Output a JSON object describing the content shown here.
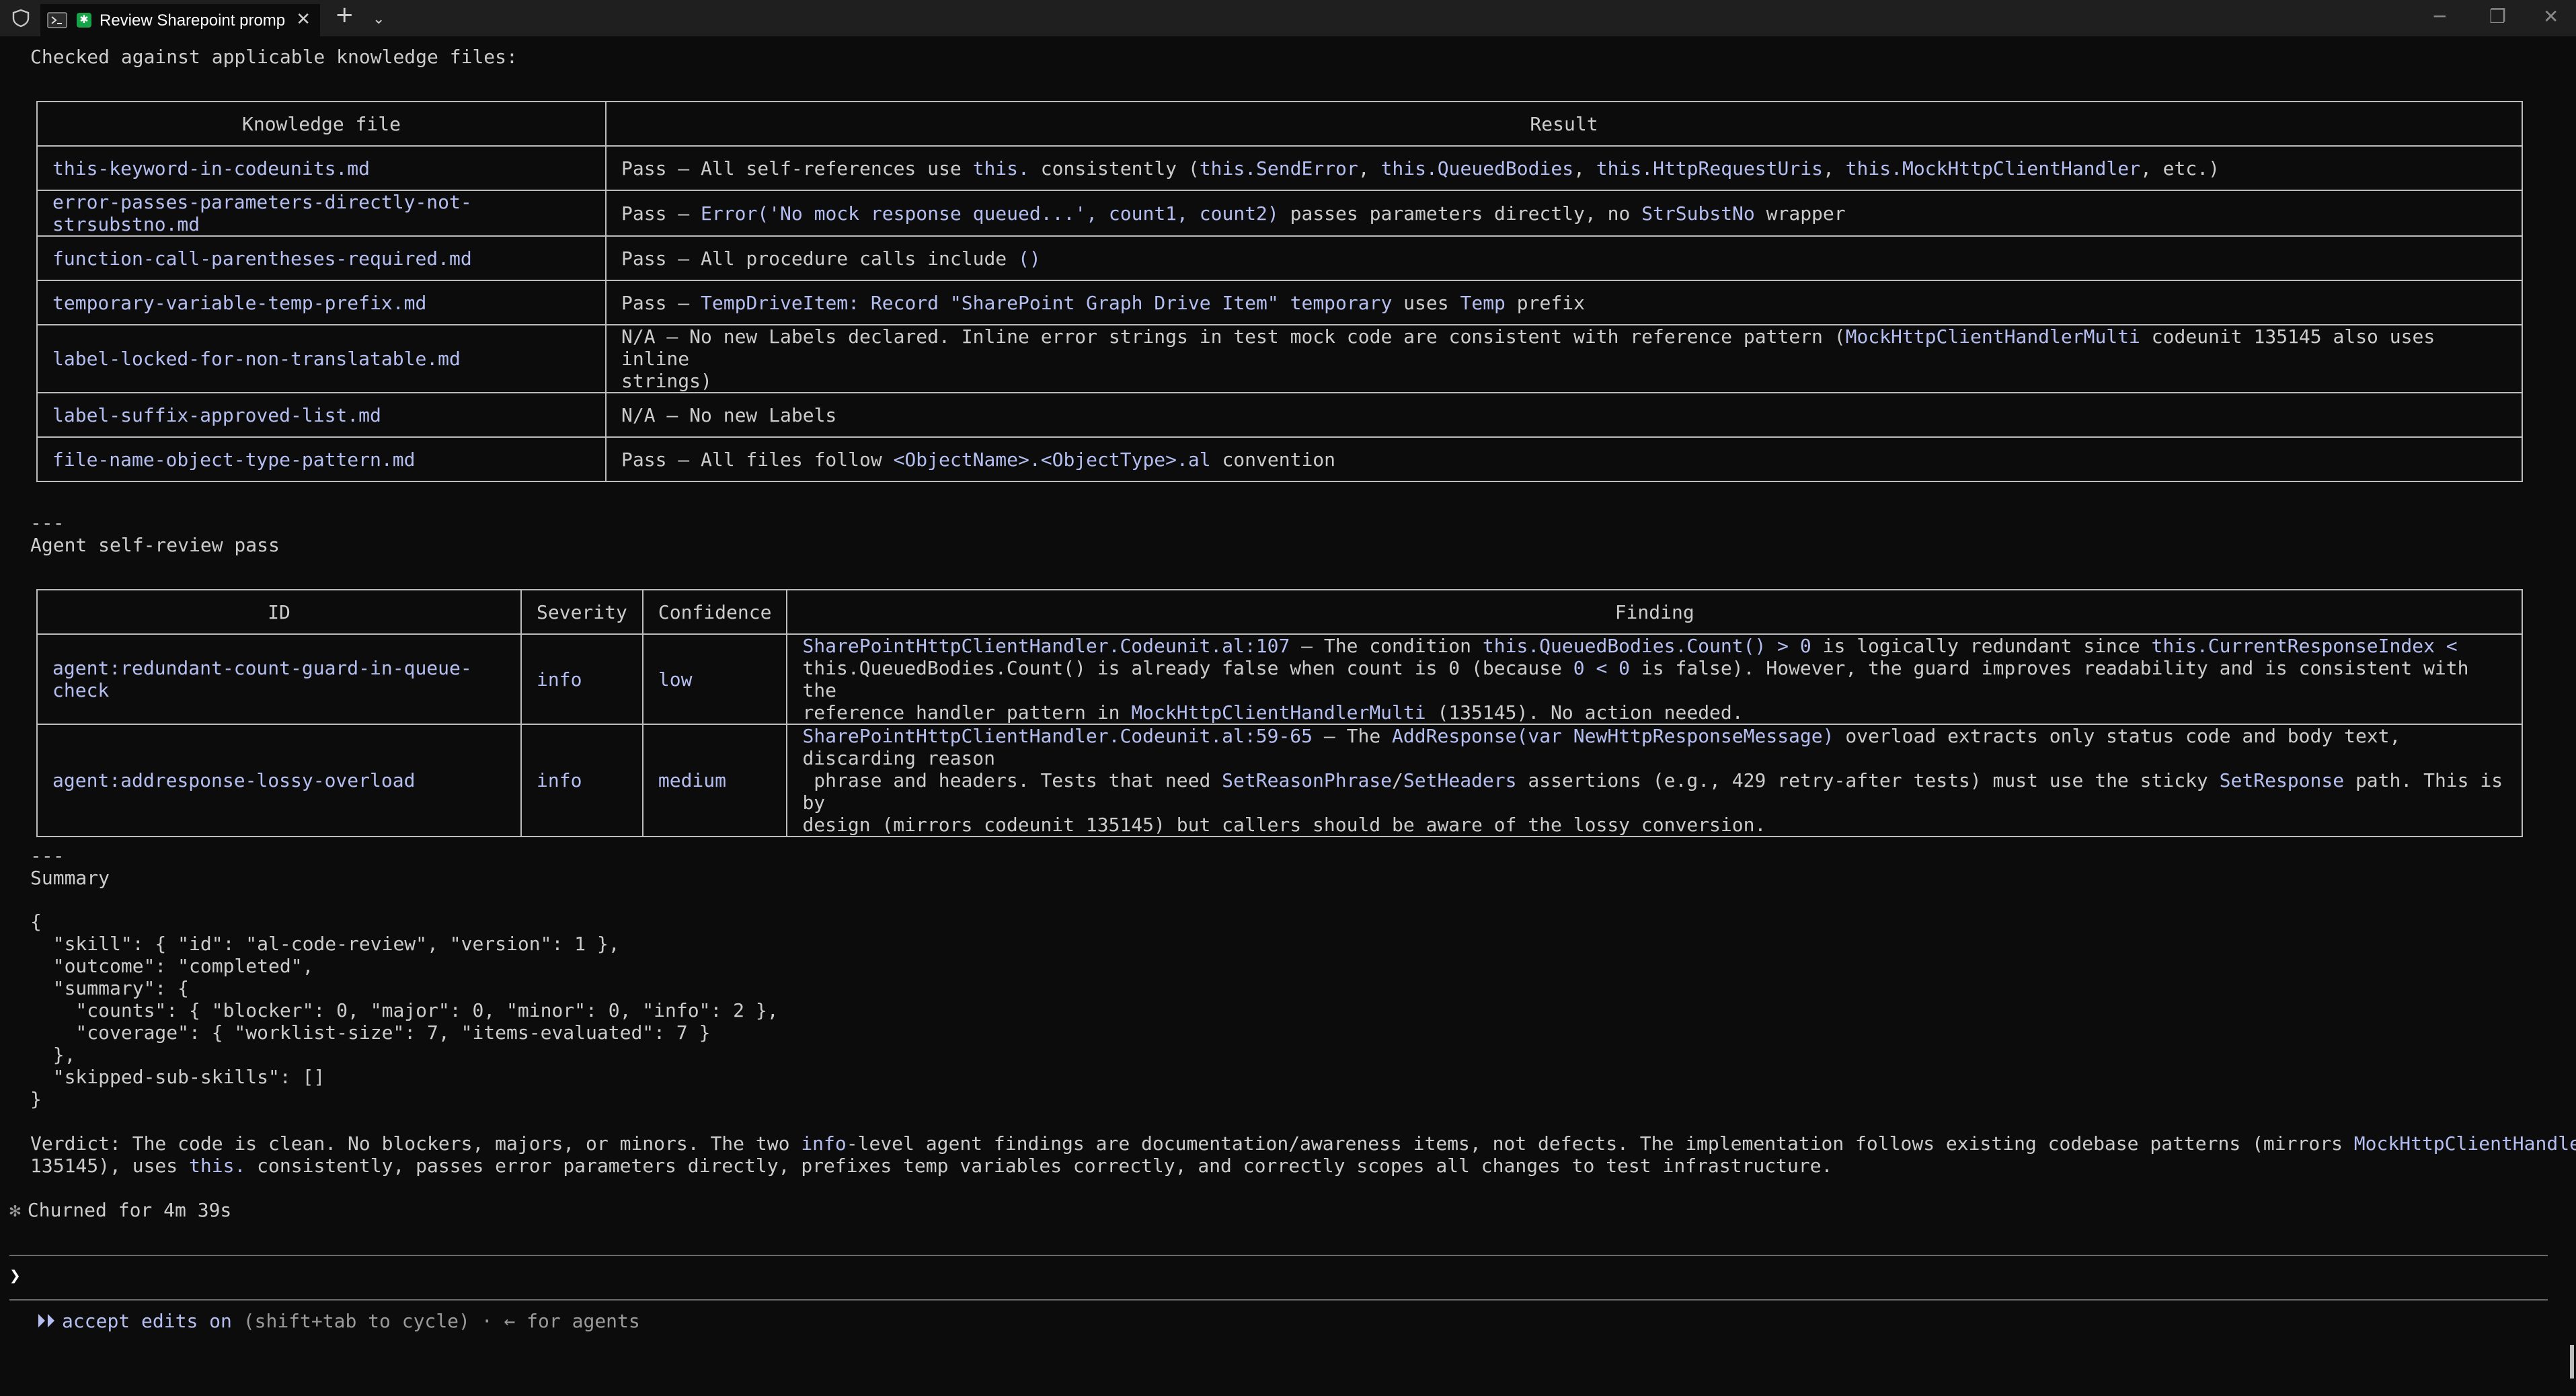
{
  "window": {
    "tab_title": "Review Sharepoint promp",
    "minimize": "─",
    "restore": "❐",
    "close": "✕",
    "new_tab": "+",
    "dropdown": "⌄"
  },
  "intro_line": "Checked against applicable knowledge files:",
  "knowledge_table": {
    "headers": [
      "Knowledge file",
      "Result"
    ],
    "rows": [
      {
        "file": "this-keyword-in-codeunits.md",
        "result": [
          [
            "Pass — All self-references use ",
            ""
          ],
          [
            "this.",
            "h"
          ],
          [
            " consistently (",
            ""
          ],
          [
            "this.SendError",
            "h"
          ],
          [
            ", ",
            ""
          ],
          [
            "this.QueuedBodies",
            "h"
          ],
          [
            ", ",
            ""
          ],
          [
            "this.HttpRequestUris",
            "h"
          ],
          [
            ", ",
            ""
          ],
          [
            "this.MockHttpClientHandler",
            "h"
          ],
          [
            ", etc.)",
            ""
          ]
        ]
      },
      {
        "file": "error-passes-parameters-directly-not-strsubstno.md",
        "result": [
          [
            "Pass — ",
            ""
          ],
          [
            "Error('No mock response queued...', count1, count2)",
            "h"
          ],
          [
            " passes parameters directly, no ",
            ""
          ],
          [
            "StrSubstNo",
            "h"
          ],
          [
            " wrapper",
            ""
          ]
        ]
      },
      {
        "file": "function-call-parentheses-required.md",
        "result": [
          [
            "Pass — All procedure calls include ",
            ""
          ],
          [
            "()",
            "h"
          ]
        ]
      },
      {
        "file": "temporary-variable-temp-prefix.md",
        "result": [
          [
            "Pass — ",
            ""
          ],
          [
            "TempDriveItem: Record \"SharePoint Graph Drive Item\" temporary",
            "h"
          ],
          [
            " uses ",
            ""
          ],
          [
            "Temp",
            "h"
          ],
          [
            " prefix",
            ""
          ]
        ]
      },
      {
        "file": "label-locked-for-non-translatable.md",
        "result": [
          [
            "N/A — No new Labels declared. Inline error strings in test mock code are consistent with reference pattern (",
            ""
          ],
          [
            "MockHttpClientHandlerMulti",
            "h"
          ],
          [
            " codeunit 135145 also uses inline\nstrings)",
            ""
          ]
        ]
      },
      {
        "file": "label-suffix-approved-list.md",
        "result": [
          [
            "N/A — No new Labels",
            ""
          ]
        ]
      },
      {
        "file": "file-name-object-type-pattern.md",
        "result": [
          [
            "Pass — All files follow ",
            ""
          ],
          [
            "<ObjectName>.<ObjectType>.al",
            "h"
          ],
          [
            " convention",
            ""
          ]
        ]
      }
    ]
  },
  "sep1": "---",
  "self_review_heading": "Agent self-review pass",
  "findings_table": {
    "headers": [
      "ID",
      "Severity",
      "Confidence",
      "Finding"
    ],
    "rows": [
      {
        "id": "agent:redundant-count-guard-in-queue-check",
        "severity": "info",
        "confidence": "low",
        "finding": [
          [
            "SharePointHttpClientHandler.Codeunit.al:107",
            "h"
          ],
          [
            " — The condition ",
            ""
          ],
          [
            "this.QueuedBodies.Count() > 0",
            "h"
          ],
          [
            " is logically redundant since ",
            ""
          ],
          [
            "this.CurrentResponseIndex <",
            "h"
          ],
          [
            "\nthis.QueuedBodies.Count() is already false when count is 0 (because ",
            ""
          ],
          [
            "0 < 0",
            "h"
          ],
          [
            " is false). However, the guard improves readability and is consistent with the\nreference handler pattern in ",
            ""
          ],
          [
            "MockHttpClientHandlerMulti",
            "h"
          ],
          [
            " (135145). No action needed.",
            ""
          ]
        ]
      },
      {
        "id": "agent:addresponse-lossy-overload",
        "severity": "info",
        "confidence": "medium",
        "finding": [
          [
            "SharePointHttpClientHandler.Codeunit.al:59-65",
            "h"
          ],
          [
            " — The ",
            ""
          ],
          [
            "AddResponse(var NewHttpResponseMessage)",
            "h"
          ],
          [
            " overload extracts only status code and body text, discarding reason\n phrase and headers. Tests that need ",
            ""
          ],
          [
            "SetReasonPhrase",
            "h"
          ],
          [
            "/",
            ""
          ],
          [
            "SetHeaders",
            "h"
          ],
          [
            " assertions (e.g., 429 retry-after tests) must use the sticky ",
            ""
          ],
          [
            "SetResponse",
            "h"
          ],
          [
            " path. This is by\ndesign (mirrors codeunit 135145) but callers should be aware of the lossy conversion.",
            ""
          ]
        ]
      }
    ]
  },
  "sep2": "---",
  "summary_heading": "Summary",
  "summary_json_lines": [
    "{",
    "  \"skill\": { \"id\": \"al-code-review\", \"version\": 1 },",
    "  \"outcome\": \"completed\",",
    "  \"summary\": {",
    "    \"counts\": { \"blocker\": 0, \"major\": 0, \"minor\": 0, \"info\": 2 },",
    "    \"coverage\": { \"worklist-size\": 7, \"items-evaluated\": 7 }",
    "  },",
    "  \"skipped-sub-skills\": []",
    "}"
  ],
  "verdict": [
    [
      "Verdict: The code is clean. No blockers, majors, or minors. The two ",
      ""
    ],
    [
      "info",
      "h"
    ],
    [
      "-level agent findings are documentation/awareness items, not defects. The implementation follows existing codebase patterns (mirrors ",
      ""
    ],
    [
      "MockHttpClientHandlerMulti",
      "h"
    ],
    [
      "\n135145), uses ",
      ""
    ],
    [
      "this.",
      "h"
    ],
    [
      " consistently, passes error parameters directly, prefixes temp variables correctly, and correctly scopes all changes to test infrastructure.",
      ""
    ]
  ],
  "churned": {
    "icon": "✻",
    "text": "Churned for 4m 39s"
  },
  "prompt_symbol": "❯",
  "status_bar": {
    "arrows": "⏵⏵",
    "mode": "accept edits on",
    "hint": " (shift+tab to cycle) · ← for agents"
  },
  "colors": {
    "highlight": "#b4bef0",
    "background": "#0c0c0c",
    "text": "#cccccc"
  }
}
